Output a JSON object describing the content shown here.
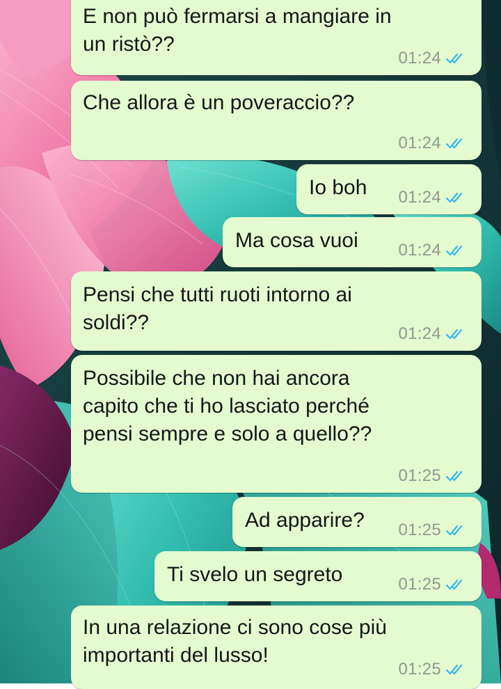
{
  "chat": {
    "messages": [
      {
        "text_lines": [
          "E non può fermarsi a mangiare in",
          "un ristò??"
        ],
        "time": "01:24",
        "status": "read-double-tick"
      },
      {
        "text_lines": [
          "Che allora è un poveraccio??"
        ],
        "time": "01:24",
        "status": "read-double-tick"
      },
      {
        "text_lines": [
          "Io boh"
        ],
        "time": "01:24",
        "status": "read-double-tick"
      },
      {
        "text_lines": [
          "Ma cosa vuoi"
        ],
        "time": "01:24",
        "status": "read-double-tick"
      },
      {
        "text_lines": [
          "Pensi che tutti ruoti intorno ai",
          "soldi??"
        ],
        "time": "01:24",
        "status": "read-double-tick"
      },
      {
        "text_lines": [
          "Possibile che non hai ancora",
          "capito che ti ho lasciato perché",
          "pensi sempre e solo a quello??"
        ],
        "time": "01:25",
        "status": "read-double-tick"
      },
      {
        "text_lines": [
          "Ad apparire?"
        ],
        "time": "01:25",
        "status": "read-double-tick"
      },
      {
        "text_lines": [
          "Ti svelo un segreto"
        ],
        "time": "01:25",
        "status": "read-double-tick"
      },
      {
        "text_lines": [
          "In una relazione ci sono cose più",
          "importanti del lusso!"
        ],
        "time": "01:25",
        "status": "read-double-tick"
      }
    ]
  },
  "colors": {
    "bubble_outgoing": "#e4fbd0",
    "message_text": "#161616",
    "timestamp": "#8d9a8d",
    "read_tick": "#34b7f1",
    "wallpaper_pink": "#f07aa8",
    "wallpaper_teal": "#3fc5b7",
    "wallpaper_dark": "#14353a",
    "wallpaper_purple": "#6b1a4f"
  },
  "icons": {
    "read_receipt": "double-check-icon"
  }
}
